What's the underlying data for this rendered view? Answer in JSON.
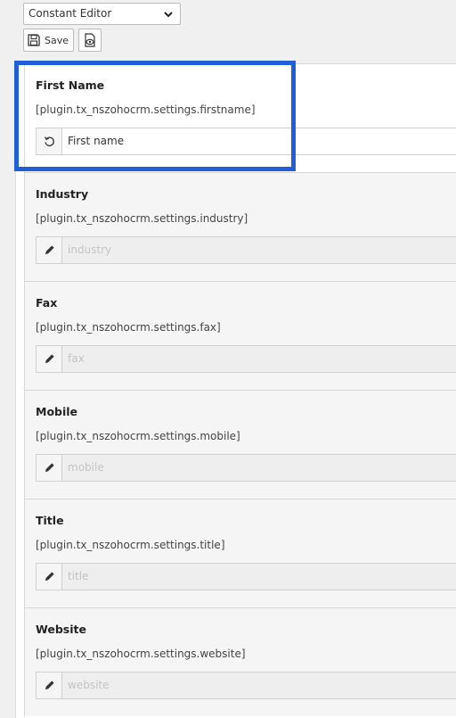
{
  "toolbar": {
    "mode_select": "Constant Editor",
    "save_label": "Save"
  },
  "fields": [
    {
      "title": "First Name",
      "key": "[plugin.tx_nszohocrm.settings.firstname]",
      "value": "First name",
      "icon": "reset-icon"
    },
    {
      "title": "Industry",
      "key": "[plugin.tx_nszohocrm.settings.industry]",
      "value": "industry",
      "icon": "pencil-icon"
    },
    {
      "title": "Fax",
      "key": "[plugin.tx_nszohocrm.settings.fax]",
      "value": "fax",
      "icon": "pencil-icon"
    },
    {
      "title": "Mobile",
      "key": "[plugin.tx_nszohocrm.settings.mobile]",
      "value": "mobile",
      "icon": "pencil-icon"
    },
    {
      "title": "Title",
      "key": "[plugin.tx_nszohocrm.settings.title]",
      "value": "title",
      "icon": "pencil-icon"
    },
    {
      "title": "Website",
      "key": "[plugin.tx_nszohocrm.settings.website]",
      "value": "website",
      "icon": "pencil-icon"
    }
  ],
  "colors": {
    "highlight": "#1f5ed6"
  }
}
